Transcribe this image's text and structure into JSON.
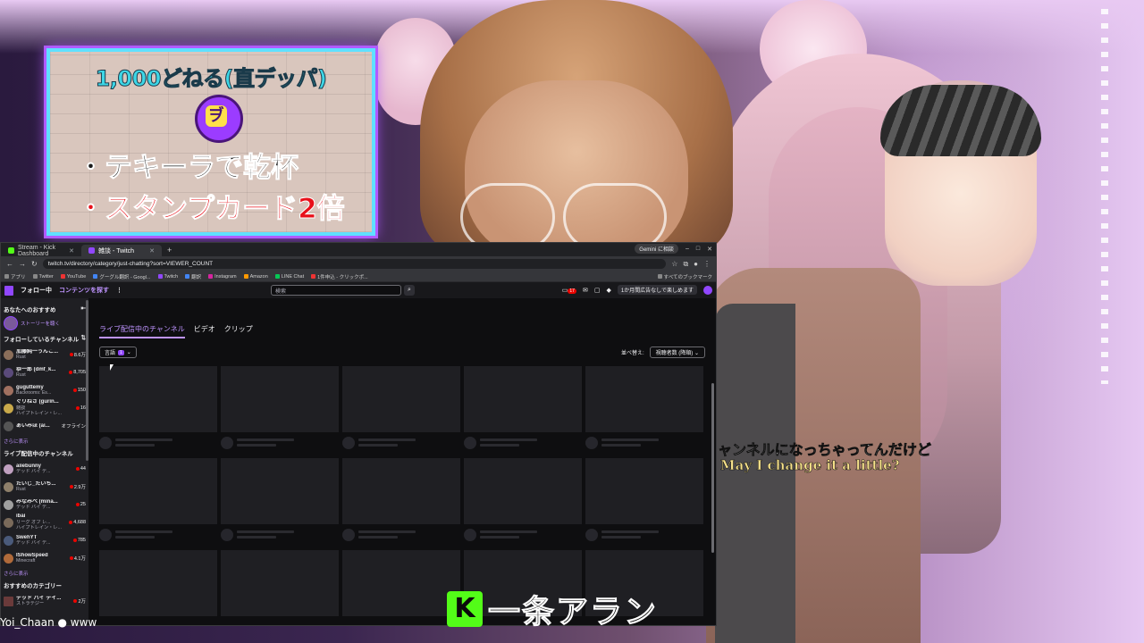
{
  "promo": {
    "title": "1,000どねる(直デッパ)",
    "badge_glyph": "ヺ",
    "line1": "・テキーラで乾杯",
    "line2": "・スタンプカード2倍"
  },
  "subtitles": {
    "ja": "ャンネルになっちゃってんだけど",
    "en": "May I change it a little?"
  },
  "nametag": {
    "logo_letter": "K",
    "name": "一条アラン"
  },
  "bottom_left": "Yoi_Chaan ● www",
  "browser": {
    "tabs": [
      {
        "label": "Stream - Kick Dashboard",
        "favicon_color": "#53fc18"
      },
      {
        "label": "雑談 - Twitch",
        "favicon_color": "#9147ff"
      }
    ],
    "new_tab": "+",
    "gemini_chip": "Gemini に相談",
    "window_controls": [
      "–",
      "□",
      "✕"
    ],
    "url": "twitch.tv/directory/category/just-chatting?sort=VIEWER_COUNT",
    "bookmarks": [
      "アプリ",
      "Twitter",
      "YouTube",
      "グーグル翻訳 - Googl...",
      "Twitch",
      "翻訳",
      "Instagram",
      "Amazon",
      "LINE Chat",
      "1件申込 - クリックポ..."
    ],
    "bookmarks_right": "すべてのブックマーク"
  },
  "twitch": {
    "nav_following": "フォロー中",
    "nav_browse": "コンテンツを探す",
    "nav_more": "⋮",
    "search_placeholder": "検索",
    "notification_count": "17",
    "adfree": "1か月間広告なしで楽しめます",
    "sidebar": {
      "recommend_heading": "あなたへのおすすめ",
      "story_label": "ストーリーを聴く",
      "following_heading": "フォローしているチャンネル",
      "following": [
        {
          "name": "加藤純一うんこ...",
          "game": "Rust",
          "count": "8.6万"
        },
        {
          "name": "恭一郎 (dmf_k...",
          "game": "Rust",
          "count": "8,705"
        },
        {
          "name": "guguttemy",
          "game": "Backrooms: Es...",
          "count": "150"
        },
        {
          "name": "ぐりねさ (gurin...",
          "game": "雑談",
          "count": "16"
        },
        {
          "name": "あいみほ (ai...",
          "game": "",
          "count": "オフライン"
        }
      ],
      "following_hosting": "ハイプトレイン・レ...",
      "show_more": "さらに表示",
      "live_heading": "ライブ配信中のチャンネル",
      "live": [
        {
          "name": "aiiebunny",
          "game": "デッド バイ デ...",
          "count": "44"
        },
        {
          "name": "たいじ_たいち...",
          "game": "Rust",
          "count": "2.9万"
        },
        {
          "name": "みなみべ (mina...",
          "game": "デッド バイ デ...",
          "count": "25"
        },
        {
          "name": "ibai",
          "game": "リーグ オブ レ...",
          "count": "4,688"
        },
        {
          "name": "SwehYT",
          "game": "デッド バイ デ...",
          "count": "785"
        },
        {
          "name": "IShowSpeed",
          "game": "Minecraft",
          "count": "4.1万"
        }
      ],
      "live_hosting": "ハイプトレイン・レ...",
      "show_more2": "さらに表示",
      "category_heading": "おすすめのカテゴリー",
      "category": [
        {
          "name": "デッド バイ デイ...",
          "game": "ストラテジー",
          "count": "2万"
        }
      ]
    },
    "tabs": [
      "ライブ配信中のチャンネル",
      "ビデオ",
      "クリップ"
    ],
    "language_label": "言語",
    "language_count": "1",
    "sort_label": "並べ替え:",
    "sort_value": "視聴者数 (降順)"
  },
  "colors": {
    "twitch_purple": "#9147ff",
    "kick_green": "#53fc18",
    "live_red": "#eb0400"
  }
}
